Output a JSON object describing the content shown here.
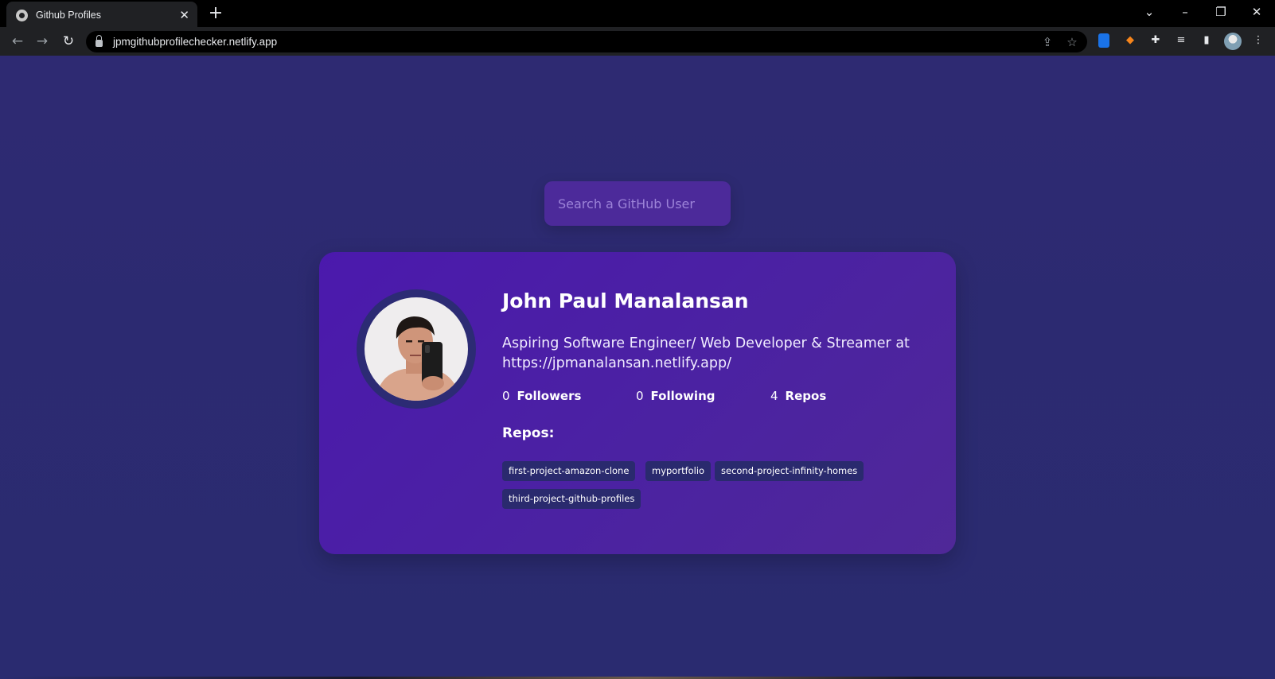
{
  "browser": {
    "tab_title": "Github Profiles",
    "url": "jpmgithubprofilechecker.netlify.app"
  },
  "search": {
    "placeholder": "Search a GitHub User"
  },
  "profile": {
    "name": "John Paul Manalansan",
    "bio": "Aspiring Software Engineer/ Web Developer & Streamer at https://jpmanalansan.netlify.app/",
    "stats": [
      {
        "value": "0",
        "label": "Followers"
      },
      {
        "value": "0",
        "label": "Following"
      },
      {
        "value": "4",
        "label": "Repos"
      }
    ]
  },
  "repos": {
    "heading": "Repos:",
    "items": [
      "first-project-amazon-clone",
      "myportfolio",
      "second-project-infinity-homes",
      "third-project-github-profiles"
    ]
  },
  "colors": {
    "page_background": "#2a2a72",
    "card_background": "#4b19ad",
    "search_background": "#4c2a9a",
    "repo_tag": "#2a2a6e"
  }
}
